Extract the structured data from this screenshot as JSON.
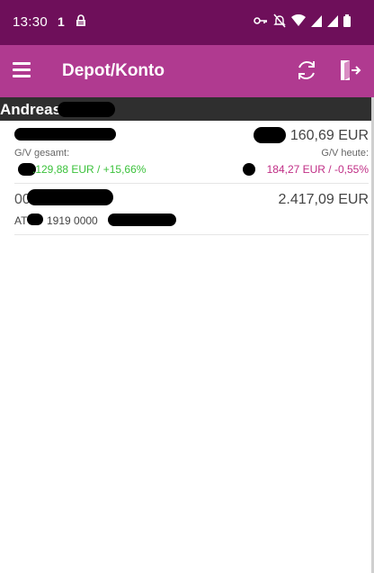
{
  "status_bar": {
    "time": "13:30",
    "notification_count": "1",
    "icons": [
      "lock-icon",
      "key-icon",
      "mute-icon",
      "wifi-icon",
      "signal-icon",
      "signal-icon",
      "battery-icon"
    ]
  },
  "app_bar": {
    "title": "Depot/Konto",
    "menu_icon": "hamburger-menu-icon",
    "refresh_icon": "refresh-icon",
    "logout_icon": "logout-icon"
  },
  "section": {
    "name": "Andreas"
  },
  "accounts": [
    {
      "amount": "160,69 EUR",
      "gv_total_label": "G/V gesamt:",
      "gv_total_value": ".129,88 EUR / +15,66%",
      "gv_today_label": "G/V heute:",
      "gv_today_value": "184,27 EUR / -0,55%"
    },
    {
      "number_prefix": "00",
      "amount": "2.417,09 EUR",
      "iban_prefix": "AT",
      "iban_middle": "1919 0000"
    }
  ],
  "colors": {
    "status_bar": "#6e0f5a",
    "app_bar": "#b03a90",
    "section_header": "#2f2f2f",
    "positive": "#3cc23c",
    "negative": "#c02e86"
  }
}
